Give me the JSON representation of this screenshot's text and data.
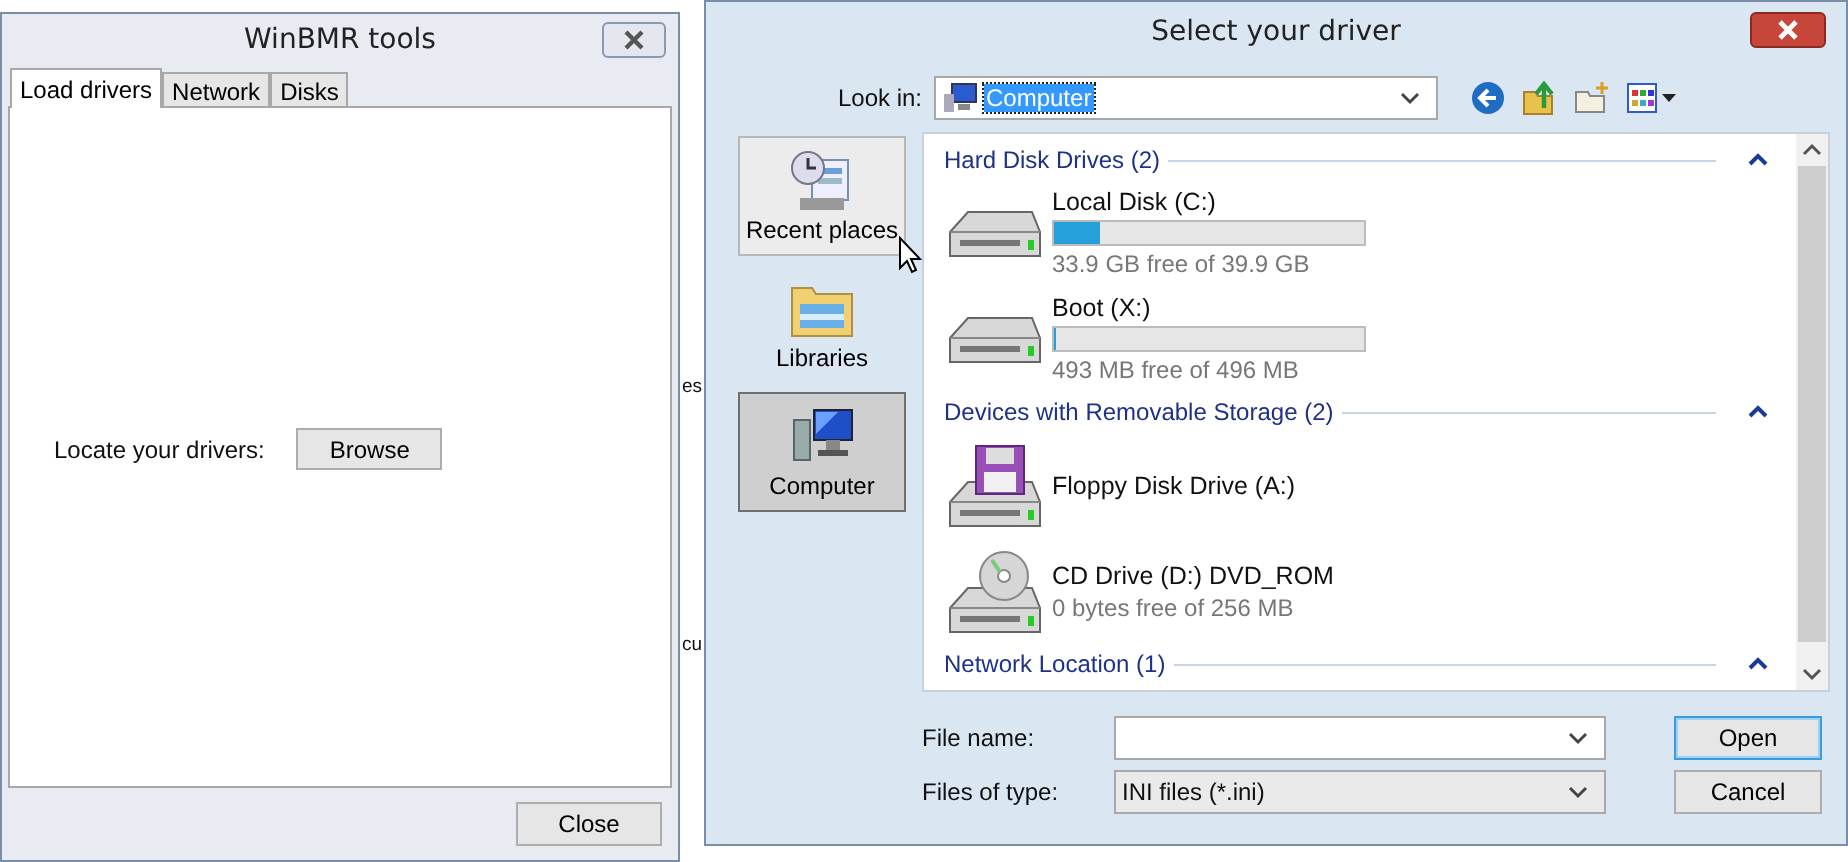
{
  "background_texts": [
    "es",
    "cu"
  ],
  "tools_window": {
    "title": "WinBMR tools",
    "tabs": [
      {
        "label": "Load drivers",
        "selected": true
      },
      {
        "label": "Network",
        "selected": false
      },
      {
        "label": "Disks",
        "selected": false
      }
    ],
    "locate_label": "Locate your drivers:",
    "browse_button": "Browse",
    "close_button": "Close"
  },
  "driver_dialog": {
    "title": "Select your driver",
    "look_in": {
      "label": "Look in:",
      "value": "Computer"
    },
    "places": [
      {
        "label": "Recent places",
        "kind": "recent",
        "selected": false
      },
      {
        "label": "Libraries",
        "kind": "libraries",
        "selected": false
      },
      {
        "label": "Computer",
        "kind": "computer",
        "selected": true
      }
    ],
    "groups": [
      {
        "title": "Hard Disk Drives (2)",
        "expanded": true,
        "items": [
          {
            "name": "Local Disk (C:)",
            "kind": "hdd",
            "level": 0.15,
            "detail": "33.9 GB free of 39.9 GB"
          },
          {
            "name": "Boot (X:)",
            "kind": "hdd",
            "level": 0.006,
            "detail": "493 MB free of 496 MB"
          }
        ]
      },
      {
        "title": "Devices with Removable Storage (2)",
        "expanded": true,
        "items": [
          {
            "name": "Floppy Disk Drive (A:)",
            "kind": "floppy"
          },
          {
            "name": "CD Drive (D:) DVD_ROM",
            "kind": "cd",
            "detail": "0 bytes free of 256 MB"
          }
        ]
      },
      {
        "title": "Network Location (1)",
        "expanded": true
      }
    ],
    "file_name": {
      "label": "File name:"
    },
    "files_of_type": {
      "label": "Files of type:",
      "value": "INI files (*.ini)"
    },
    "buttons": [
      {
        "label": "Open",
        "default": true
      },
      {
        "label": "Cancel",
        "default": false
      }
    ]
  }
}
